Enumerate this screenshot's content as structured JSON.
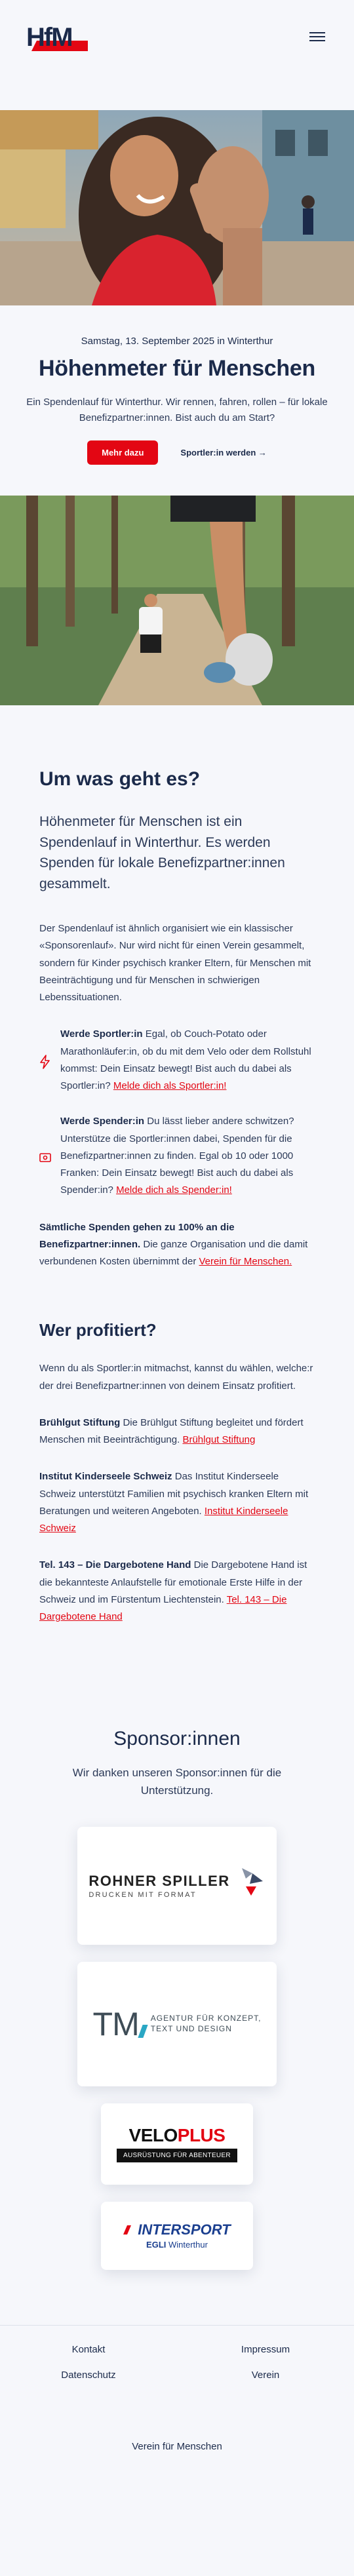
{
  "header": {
    "logo_alt": "HfM",
    "menu_icon": "hamburger-icon"
  },
  "hero": {
    "date": "Samstag, 13. September 2025 in Winterthur",
    "title": "Höhenmeter für Menschen",
    "subtitle": "Ein Spendenlauf für Winterthur. Wir rennen, fahren, rollen – für lokale Benefizpartner:innen. Bist auch du am Start?",
    "primary_button": "Mehr dazu",
    "secondary_link": "Sportler:in werden →"
  },
  "about": {
    "title": "Um was geht es?",
    "lead": "Höhenmeter für Menschen ist ein Spendenlauf in Winterthur. Es werden Spenden für lokale Benefizpartner:innen gesammelt.",
    "paragraph": "Der Spendenlauf ist ähnlich organisiert wie ein klassischer «Sponsorenlauf». Nur wird nicht für einen Verein gesammelt, sondern für Kinder psychisch kranker Eltern, für Menschen mit Beeinträchtigung und für Menschen in schwierigen Lebenssituationen.",
    "features": [
      {
        "icon": "lightning-icon",
        "bold": "Werde Sportler:in",
        "text": " Egal, ob Couch-Potato oder Marathonläufer:in, ob du mit dem Velo oder dem Rollstuhl kommst: Dein Einsatz bewegt! Bist auch du dabei als Sportler:in? ",
        "link": "Melde dich als Sportler:in!"
      },
      {
        "icon": "money-icon",
        "bold": "Werde Spender:in",
        "text": " Du lässt lieber andere schwitzen? Unterstütze die Sportler:innen dabei, Spenden für die Benefizpartner:innen zu finden. Egal ob 10 oder 1000 Franken: Dein Einsatz bewegt! Bist auch du dabei als Spender:in? ",
        "link": "Melde dich als Spender:in!"
      }
    ],
    "donations_bold": "Sämtliche Spenden gehen zu 100% an die Benefizpartner:innen.",
    "donations_text": " Die ganze Organisation und die damit verbundenen Kosten übernimmt der ",
    "donations_link": "Verein für Menschen."
  },
  "beneficiaries": {
    "title": "Wer profitiert?",
    "intro": "Wenn du als Sportler:in mitmachst, kannst du wählen, welche:r der drei Benefizpartner:innen von deinem Einsatz profitiert.",
    "items": [
      {
        "name": "Brühlgut Stiftung",
        "text": " Die Brühlgut Stiftung begleitet und fördert Menschen mit Beeinträchtigung. ",
        "link": "Brühlgut Stiftung"
      },
      {
        "name": "Institut Kinderseele Schweiz",
        "text": " Das Institut Kinderseele Schweiz unterstützt Familien mit psychisch kranken Eltern mit Beratungen und weiteren Angeboten. ",
        "link": "Institut Kinderseele Schweiz"
      },
      {
        "name": "Tel. 143 – Die Dargebotene Hand",
        "text": " Die Dargebotene Hand ist die bekannteste Anlaufstelle für emotionale Erste Hilfe in der Schweiz und im Fürstentum Liechtenstein. ",
        "link": "Tel. 143 – Die Dargebotene Hand"
      }
    ]
  },
  "sponsors": {
    "title": "Sponsor:innen",
    "subtitle": "Wir danken unseren Sponsor:innen für die Unterstützung.",
    "rohner": {
      "name": "ROHNER SPILLER",
      "tagline": "DRUCKEN MIT FORMAT"
    },
    "tm": {
      "mark": "TM",
      "tagline_1": "AGENTUR FÜR KONZEPT,",
      "tagline_2": "TEXT UND DESIGN"
    },
    "veloplus": {
      "name_1": "VELO",
      "name_2": "PLUS",
      "tagline": "AUSRÜSTUNG FÜR ABENTEUER"
    },
    "intersport": {
      "name": "INTERSPORT",
      "store": "EGLI",
      "city": "Winterthur"
    }
  },
  "footer": {
    "links": [
      "Kontakt",
      "Impressum",
      "Datenschutz",
      "Verein"
    ],
    "bottom": "Verein für Menschen"
  },
  "colors": {
    "accent": "#e30613",
    "navy": "#1b2a4a",
    "background": "#f6f7fb"
  }
}
